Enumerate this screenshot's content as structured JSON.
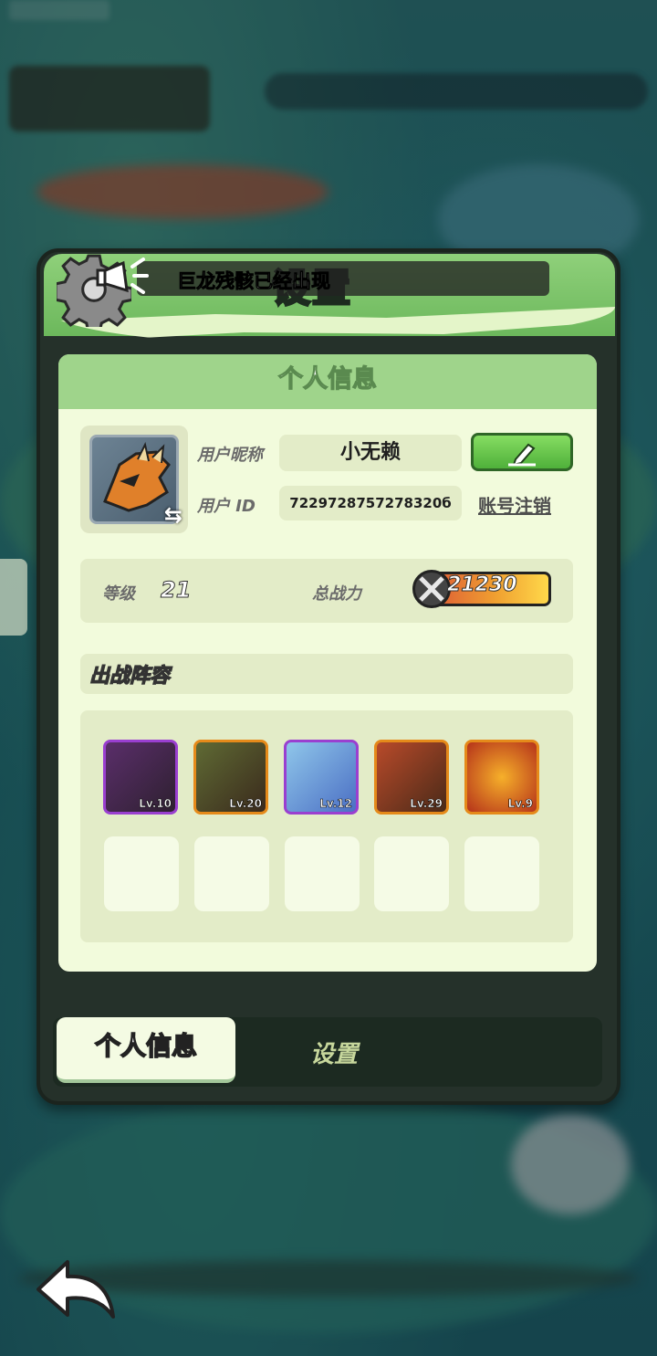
{
  "header": {
    "title": "设置",
    "notice": "巨龙残骸已经出现"
  },
  "profile": {
    "section_title": "个人信息",
    "nickname_label": "用户昵称",
    "nickname_value": "小无赖",
    "id_label": "用户 ID",
    "id_value": "7229728757278320б",
    "logout_label": "账号注销",
    "level_label": "等级",
    "level_value": "21",
    "power_label": "总战力",
    "power_value": "21230"
  },
  "lineup": {
    "title": "出战阵容",
    "heroes": [
      {
        "level": "Lv.10",
        "frame": "#9a3fd0"
      },
      {
        "level": "Lv.20",
        "frame": "#e58a1a"
      },
      {
        "level": "Lv.12",
        "frame": "#9a3fd0"
      },
      {
        "level": "Lv.29",
        "frame": "#e58a1a"
      },
      {
        "level": "Lv.9",
        "frame": "#e58a1a"
      }
    ]
  },
  "tabs": {
    "profile": "个人信息",
    "settings": "设置"
  },
  "icons": {
    "gear": "gear-icon",
    "megaphone": "megaphone-icon",
    "edit": "pencil-icon",
    "back": "back-arrow-icon",
    "swap": "swap-icon",
    "power": "crossed-swords-icon"
  }
}
